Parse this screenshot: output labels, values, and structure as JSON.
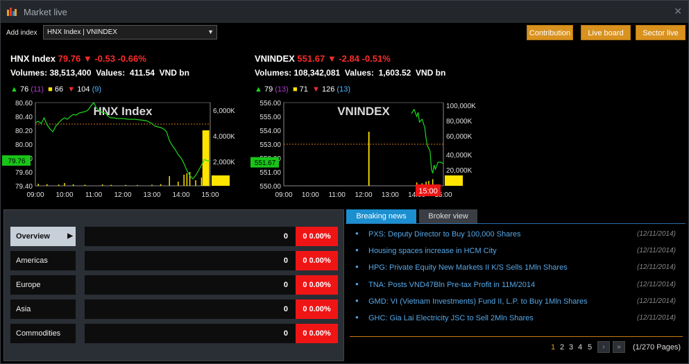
{
  "window": {
    "title": "Market live",
    "close_icon": "close-icon"
  },
  "toolbar": {
    "add_index_label": "Add index",
    "index_select_value": "HNX Index | VNINDEX",
    "buttons": [
      "Contribution",
      "Live board",
      "Sector live"
    ]
  },
  "colors": {
    "up": "#1ed81e",
    "down": "#ff2b2b",
    "flat": "#ffe400",
    "accent": "#d9921e",
    "tab_active": "#1b8fd0"
  },
  "hnx": {
    "name": "HNX Index",
    "value": "79.76",
    "arrow": "▼",
    "change": "-0.53",
    "pct": "-0.66%",
    "volumes_label": "Volumes:",
    "volumes": "38,513,400",
    "values_label": "Values:",
    "values": "411.54",
    "unit": "VND bn",
    "up": "76",
    "up_ceiling": "(11)",
    "flat": "66",
    "down": "104",
    "down_floor": "(9)"
  },
  "vni": {
    "name": "VNINDEX",
    "value": "551.67",
    "arrow": "▼",
    "change": "-2.84",
    "pct": "-0.51%",
    "volumes_label": "Volumes:",
    "volumes": "108,342,081",
    "values_label": "Values:",
    "values": "1,603.52",
    "unit": "VND bn",
    "up": "79",
    "up_ceiling": "(13)",
    "flat": "71",
    "down": "126",
    "down_floor": "(13)"
  },
  "chart_data": [
    {
      "type": "line",
      "title": "HNX Index",
      "x_ticks": [
        "09:00",
        "10:00",
        "11:00",
        "12:00",
        "13:00",
        "14:00",
        "15:00"
      ],
      "y_ticks": [
        "80.60",
        "80.40",
        "80.20",
        "80.00",
        "79.80",
        "79.60",
        "79.40"
      ],
      "y2_ticks": [
        "6,000K",
        "4,000K",
        "2,000K",
        "0K"
      ],
      "ylim": [
        79.4,
        80.6
      ],
      "reference": 80.29,
      "current_label": "79.76",
      "x": [
        0,
        0.1,
        0.2,
        0.3,
        0.4,
        0.5,
        0.6,
        0.7,
        0.8,
        0.9,
        1.0,
        1.1,
        1.2,
        1.3,
        1.4,
        1.5,
        1.6,
        1.7,
        1.8,
        1.9,
        2.0,
        2.1,
        2.2,
        2.3,
        2.4,
        2.5,
        2.6,
        2.7,
        2.8,
        2.9,
        3.0,
        3.2,
        3.4,
        3.6,
        3.8,
        4.0,
        4.1,
        4.2,
        4.3,
        4.4,
        4.5,
        4.6,
        4.7,
        4.8,
        4.9,
        5.0,
        5.1,
        5.2,
        5.3,
        5.4,
        5.5,
        5.6,
        5.7,
        5.8,
        5.9,
        6.0
      ],
      "y": [
        80.31,
        80.33,
        80.3,
        80.38,
        80.28,
        80.22,
        80.18,
        80.26,
        80.31,
        80.35,
        80.38,
        80.36,
        80.4,
        80.43,
        80.42,
        80.45,
        80.46,
        80.47,
        80.49,
        80.55,
        80.6,
        80.52,
        80.48,
        80.46,
        80.45,
        80.4,
        80.38,
        80.38,
        80.37,
        80.37,
        80.37,
        80.36,
        80.36,
        80.35,
        80.34,
        80.3,
        80.26,
        80.25,
        80.24,
        80.22,
        80.18,
        80.05,
        79.98,
        79.92,
        79.85,
        79.8,
        79.72,
        79.62,
        79.55,
        79.5,
        79.55,
        79.62,
        79.7,
        79.78,
        79.76,
        79.76
      ],
      "volume_x": [
        0.1,
        0.4,
        0.8,
        1.0,
        1.3,
        1.7,
        2.3,
        2.6,
        3.1,
        3.5,
        4.0,
        4.3,
        4.6,
        4.9,
        5.1,
        5.2,
        5.3,
        5.5,
        5.7,
        5.85
      ],
      "volume": [
        150,
        120,
        90,
        200,
        110,
        80,
        100,
        70,
        60,
        60,
        80,
        120,
        700,
        300,
        800,
        900,
        1000,
        400,
        600,
        4000
      ]
    },
    {
      "type": "line",
      "title": "VNINDEX",
      "x_ticks": [
        "09:00",
        "10:00",
        "11:00",
        "12:00",
        "13:00",
        "14:00",
        "15:00"
      ],
      "y_ticks": [
        "556.00",
        "555.00",
        "554.00",
        "553.00",
        "552.00",
        "551.00",
        "550.00"
      ],
      "y2_ticks": [
        "100,000K",
        "80,000K",
        "60,000K",
        "40,000K",
        "20,000K",
        "0K"
      ],
      "ylim": [
        550,
        556
      ],
      "reference": 553.0,
      "current_label": "551.67",
      "marker_label": "15:00",
      "x": [
        4.8,
        4.9,
        5.0,
        5.05,
        5.1,
        5.2,
        5.3,
        5.35,
        5.4,
        5.5,
        5.55,
        5.6,
        5.65,
        5.7,
        5.8,
        5.9,
        6.0
      ],
      "y": [
        555.2,
        555.5,
        555.0,
        555.3,
        554.6,
        554.8,
        554.2,
        553.4,
        552.9,
        552.5,
        551.2,
        550.9,
        551.5,
        551.2,
        551.7,
        551.7,
        551.6
      ],
      "volume_x": [
        3.2,
        5.0,
        5.2,
        5.35,
        5.45,
        5.6
      ],
      "volume": [
        65000,
        4000,
        3000,
        5000,
        6000,
        8000
      ]
    }
  ],
  "markets": {
    "rows": [
      {
        "label": "Overview",
        "value": "0",
        "change": "0 0.00%",
        "active": true
      },
      {
        "label": "Americas",
        "value": "0",
        "change": "0 0.00%",
        "active": false
      },
      {
        "label": "Europe",
        "value": "0",
        "change": "0 0.00%",
        "active": false
      },
      {
        "label": "Asia",
        "value": "0",
        "change": "0 0.00%",
        "active": false
      },
      {
        "label": "Commodities",
        "value": "0",
        "change": "0 0.00%",
        "active": false
      }
    ]
  },
  "news": {
    "tabs": [
      "Breaking news",
      "Broker view"
    ],
    "items": [
      {
        "title": "PXS: Deputy Director to Buy 100,000 Shares",
        "date": "(12/11/2014)"
      },
      {
        "title": "Housing spaces increase in HCM City",
        "date": "(12/11/2014)"
      },
      {
        "title": "HPG: Private Equity New Markets II K/S Sells 1Mln Shares",
        "date": "(12/11/2014)"
      },
      {
        "title": "TNA: Posts VND47Bln Pre-tax Profit in 11M/2014",
        "date": "(12/11/2014)"
      },
      {
        "title": "GMD:  VI (Vietnam Investments) Fund II, L.P. to Buy 1Mln Shares",
        "date": "(12/11/2014)"
      },
      {
        "title": "GHC: Gia Lai Electricity JSC to Sell 2Mln Shares",
        "date": "(12/11/2014)"
      }
    ],
    "pager": {
      "pages": [
        "1",
        "2",
        "3",
        "4",
        "5"
      ],
      "next": "›",
      "last": "»",
      "total": "(1/270 Pages)"
    }
  }
}
